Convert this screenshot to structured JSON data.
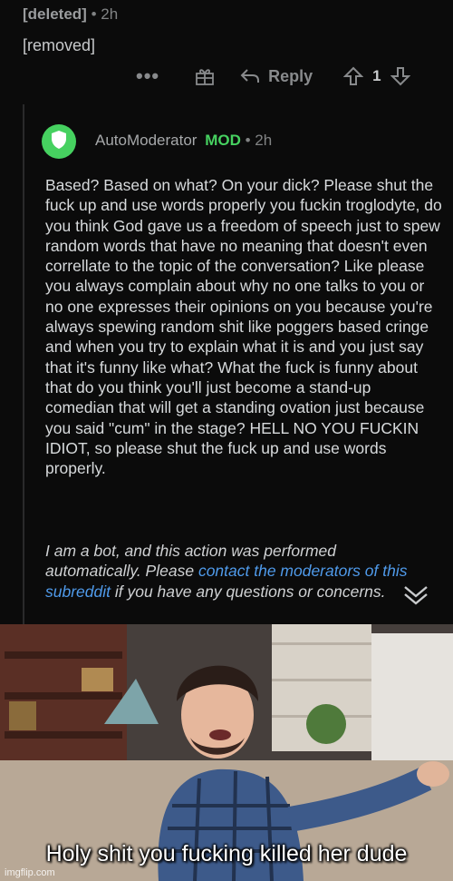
{
  "parent_comment": {
    "author": "[deleted]",
    "separator": "•",
    "time": "2h",
    "body": "[removed]",
    "actions": {
      "more_label": "•••",
      "award_icon": "gift-award-icon",
      "reply_label": "Reply",
      "score": "1"
    }
  },
  "reply": {
    "author": "AutoModerator",
    "mod_badge": "MOD",
    "separator": "•",
    "time": "2h",
    "avatar_icon": "shield-icon",
    "avatar_color": "#46d160",
    "body": "Based? Based on what? On your dick? Please shut the fuck up and use words properly you fuckin troglodyte, do you think God gave us a freedom of speech just to spew random words that have no meaning that doesn't even correllate to the topic of the conversation? Like please you always complain about why no one talks to you or no one expresses their opinions on you because you're always spewing random shit like poggers based cringe and when you try to explain what it is and you just say that it's funny like what? What the fuck is funny about that do you think you'll just become a stand-up comedian that will get a standing ovation just because you said \"cum\" in the stage? HELL NO YOU FUCKIN IDIOT, so please shut the fuck up and use words properly.",
    "bot_notice_prefix": "I am a bot, and this action was performed automatically. Please ",
    "bot_notice_link": "contact the moderators of this subreddit",
    "bot_notice_suffix": " if you have any questions or concerns."
  },
  "meme": {
    "caption": "Holy shit you fucking killed her dude",
    "watermark": "imgflip.com"
  },
  "colors": {
    "background": "#0b0b0b",
    "mod_green": "#46d160",
    "link_blue": "#4f9aea"
  }
}
